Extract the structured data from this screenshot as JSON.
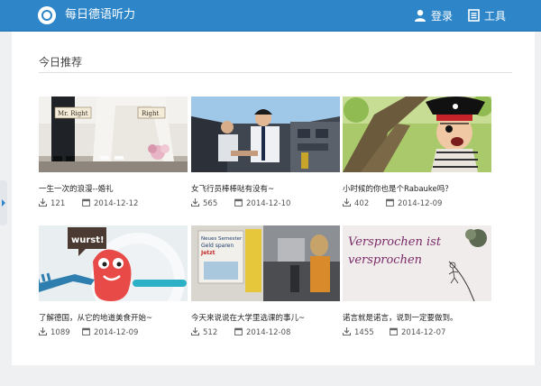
{
  "app": {
    "title": "每日德语听力"
  },
  "nav": {
    "login_label": "登录",
    "tools_label": "工具"
  },
  "section": {
    "title": "今日推荐"
  },
  "cards": [
    {
      "title": "一生一次的浪漫--婚礼",
      "downloads": "121",
      "date": "2014-12-12",
      "sign_left": "Mr. Right",
      "sign_right": "Right"
    },
    {
      "title": "女飞行员棒棒哒有没有~",
      "downloads": "565",
      "date": "2014-12-10"
    },
    {
      "title": "小时候的你也是个Rabauke吗？",
      "downloads": "402",
      "date": "2014-12-09"
    },
    {
      "title": "了解德国，从它的地道美食开始~",
      "downloads": "1089",
      "date": "2014-12-09",
      "bubble_text": "wurst!"
    },
    {
      "title": "今天来说说在大学里选课的事儿~",
      "downloads": "512",
      "date": "2014-12-08",
      "poster_text": [
        "Neues Semester",
        "Geld sparen",
        "Jetzt"
      ]
    },
    {
      "title": "诺言就是诺言，说到一定要做到。",
      "downloads": "1455",
      "date": "2014-12-07",
      "slogan_lines": [
        "Versprochen ist",
        "versprochen"
      ]
    }
  ]
}
